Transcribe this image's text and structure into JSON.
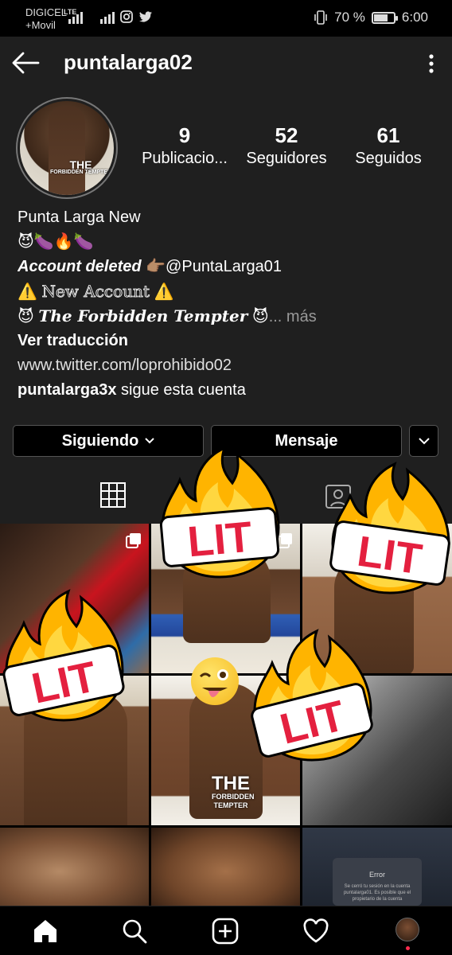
{
  "status_bar": {
    "carrier_line1": "DIGICEL",
    "carrier_line2": "+Movil",
    "network": "LTE",
    "battery": "70 %",
    "battery_level": 0.7,
    "time": "6:00"
  },
  "header": {
    "title": "puntalarga02",
    "back_icon": "arrow-left-icon",
    "more_icon": "more-vertical-icon"
  },
  "profile": {
    "avatar_text": "THE",
    "avatar_subtext": "FORBIDDEN TEMPTER",
    "stats": [
      {
        "value": "9",
        "label": "Publicacio..."
      },
      {
        "value": "52",
        "label": "Seguidores"
      },
      {
        "value": "61",
        "label": "Seguidos"
      }
    ],
    "name": "Punta Larga New",
    "emoji_line": "😈🍆🔥🍆",
    "deleted_text": "Account deleted",
    "deleted_pointer": "👉🏽",
    "deleted_handle": "@PuntaLarga01",
    "warn_icon": "⚠️",
    "new_account": "New Account",
    "devil_icon": "😈",
    "tagline": "The Forbidden Tempter",
    "more_link": "... más",
    "translate": "Ver traducción",
    "website": "www.twitter.com/loprohibido02",
    "followed_by_user": "puntalarga3x",
    "followed_by_text": "sigue esta cuenta"
  },
  "actions": {
    "following": "Siguiendo",
    "message": "Mensaje"
  },
  "tabs": {
    "grid_icon": "grid-icon",
    "tagged_icon": "tagged-icon"
  },
  "grid_overlays": {
    "sticker_text": "LIT",
    "center_label": "THE",
    "center_sublabel": "FORBIDDEN TEMPTER"
  },
  "error_dialog": {
    "title": "Error",
    "message": "Se cerró tu sesión en la cuenta puntalarga01. Es posible que el propietario de la cuenta"
  },
  "bottom_nav": [
    "home-icon",
    "search-icon",
    "add-post-icon",
    "heart-icon",
    "profile-avatar"
  ]
}
